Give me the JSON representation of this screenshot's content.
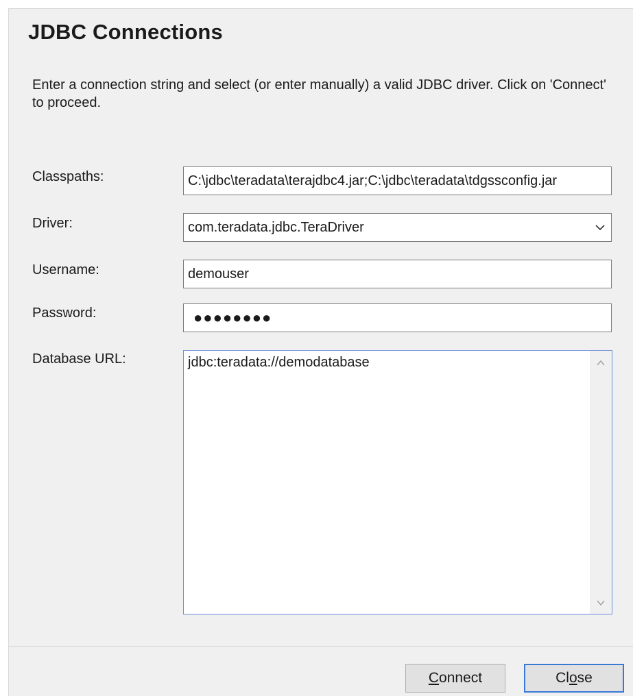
{
  "dialog": {
    "title": "JDBC Connections",
    "description": "Enter a connection string and select (or enter manually) a valid JDBC driver. Click on 'Connect' to proceed."
  },
  "form": {
    "classpaths_label": "Classpaths:",
    "classpaths_value": "C:\\jdbc\\teradata\\terajdbc4.jar;C:\\jdbc\\teradata\\tdgssconfig.jar",
    "driver_label": "Driver:",
    "driver_value": "com.teradata.jdbc.TeraDriver",
    "username_label": "Username:",
    "username_value": "demouser",
    "password_label": "Password:",
    "password_masked": "●●●●●●●●",
    "database_url_label": "Database URL:",
    "database_url_value": "jdbc:teradata://demodatabase"
  },
  "buttons": {
    "connect_accel": "C",
    "connect_rest": "onnect",
    "close_pre": "Cl",
    "close_accel": "o",
    "close_rest": "se"
  },
  "icons": {
    "driver_dropdown": "chevron-down-icon",
    "scroll_up": "chevron-up-icon",
    "scroll_down": "chevron-down-icon"
  },
  "colors": {
    "dialog_bg": "#f0f0f0",
    "focus_border": "#6b8fd6",
    "default_button_border": "#3a78d6"
  }
}
